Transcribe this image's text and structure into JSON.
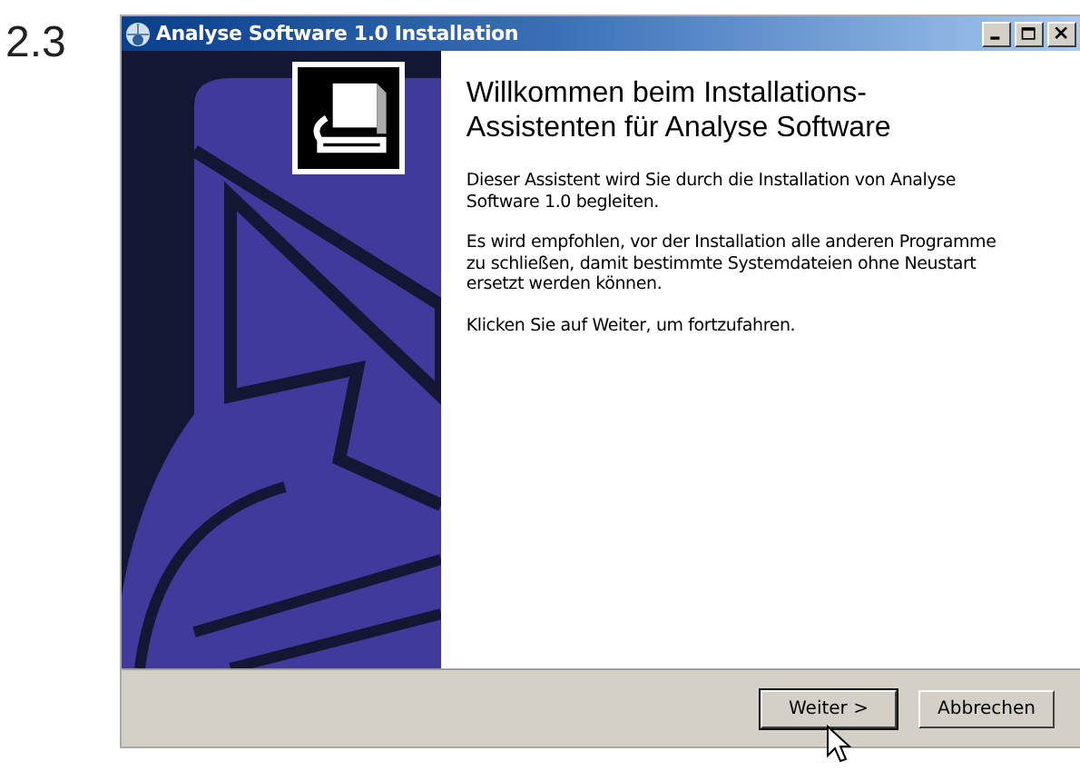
{
  "section_number": "2.3",
  "window": {
    "title": "Analyse Software 1.0 Installation"
  },
  "heading": [
    "Willkommen beim Installations-",
    "Assistenten für Analyse Software"
  ],
  "paragraphs": [
    "Dieser Assistent wird Sie durch die Installation von Analyse Software 1.0 begleiten.",
    "Es wird empfohlen, vor der Installation alle anderen Programme zu schließen, damit bestimmte Systemdateien ohne Neustart ersetzt werden können.",
    "Klicken Sie auf Weiter, um fortzufahren."
  ],
  "buttons": [
    {
      "label": "Weiter >",
      "default": true
    },
    {
      "label": "Abbrechen",
      "default": false
    }
  ]
}
